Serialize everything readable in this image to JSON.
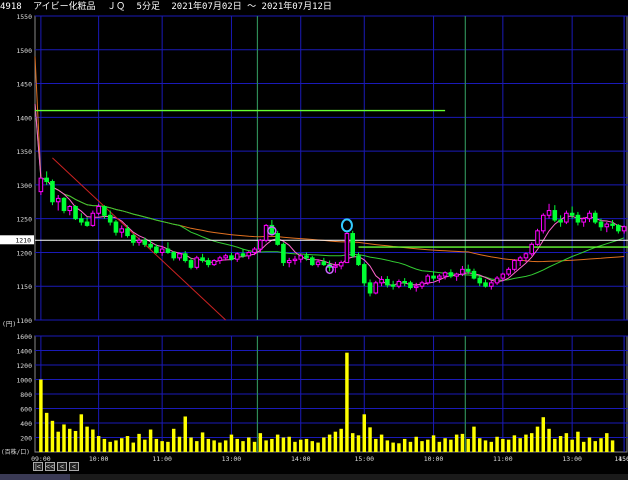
{
  "header": {
    "code": "4918",
    "name": "アイビー化粧品",
    "market": "ＪＱ",
    "interval": "5分足",
    "date_range": "2021年07月02日 〜 2021年07月12日"
  },
  "colors": {
    "background": "#000000",
    "grid": "#1a1ab8",
    "session_separator": "#2e8b57",
    "candle_up": "#ff00ff",
    "candle_down": "#00ff33",
    "volume": "#ffff00",
    "ma_short": "#ff66cc",
    "ma_mid": "#33cc33",
    "ma_long": "#e07020",
    "trend_line": "#cc2222",
    "resistance_line": "#66ff33",
    "price_line": "#ffffff",
    "marker_blue": "#33ccff",
    "marker_purple": "#cc66ff"
  },
  "price_axis": {
    "ticks": [
      "1550",
      "1500",
      "1450",
      "1400",
      "1350",
      "1300",
      "1250",
      "1200",
      "1150",
      "1100"
    ],
    "current": "1210",
    "unit": "(円)"
  },
  "volume_axis": {
    "ticks": [
      "1600",
      "1400",
      "1200",
      "1000",
      "800",
      "600",
      "400",
      "200"
    ],
    "unit": "(百株/口)"
  },
  "time_axis": {
    "labels": [
      "09:00",
      "10:00",
      "11:00",
      "13:00",
      "14:00",
      "15:00",
      "10:00",
      "11:00",
      "13:00",
      "14:00",
      "15:"
    ]
  },
  "nav": {
    "first": "|<",
    "prev_page": "<<",
    "prev": "<",
    "next": "<"
  },
  "chart_data": {
    "type": "candlestick",
    "ylim": [
      1100,
      1550
    ],
    "volume_ylim": [
      0,
      1600
    ],
    "session_breaks_at_index": [
      38,
      74,
      110
    ],
    "resistance_level": 1410,
    "current_price": 1210,
    "candles": [
      [
        1290,
        1310,
        1285,
        1310
      ],
      [
        1310,
        1320,
        1300,
        1305
      ],
      [
        1305,
        1308,
        1270,
        1275
      ],
      [
        1275,
        1285,
        1262,
        1280
      ],
      [
        1280,
        1282,
        1258,
        1262
      ],
      [
        1262,
        1270,
        1255,
        1268
      ],
      [
        1268,
        1270,
        1248,
        1250
      ],
      [
        1250,
        1258,
        1240,
        1245
      ],
      [
        1245,
        1252,
        1238,
        1240
      ],
      [
        1240,
        1262,
        1238,
        1258
      ],
      [
        1258,
        1272,
        1255,
        1268
      ],
      [
        1268,
        1270,
        1250,
        1255
      ],
      [
        1255,
        1262,
        1240,
        1245
      ],
      [
        1245,
        1248,
        1225,
        1230
      ],
      [
        1230,
        1240,
        1222,
        1235
      ],
      [
        1235,
        1240,
        1222,
        1225
      ],
      [
        1225,
        1228,
        1210,
        1215
      ],
      [
        1215,
        1222,
        1210,
        1218
      ],
      [
        1218,
        1222,
        1208,
        1212
      ],
      [
        1212,
        1218,
        1205,
        1208
      ],
      [
        1208,
        1212,
        1198,
        1200
      ],
      [
        1200,
        1210,
        1195,
        1205
      ],
      [
        1205,
        1215,
        1198,
        1200
      ],
      [
        1200,
        1202,
        1188,
        1192
      ],
      [
        1192,
        1200,
        1188,
        1198
      ],
      [
        1198,
        1202,
        1185,
        1188
      ],
      [
        1188,
        1192,
        1175,
        1178
      ],
      [
        1178,
        1195,
        1175,
        1192
      ],
      [
        1192,
        1198,
        1185,
        1188
      ],
      [
        1188,
        1192,
        1178,
        1182
      ],
      [
        1182,
        1190,
        1180,
        1188
      ],
      [
        1188,
        1195,
        1183,
        1192
      ],
      [
        1192,
        1198,
        1188,
        1195
      ],
      [
        1195,
        1200,
        1188,
        1190
      ],
      [
        1190,
        1200,
        1186,
        1198
      ],
      [
        1198,
        1205,
        1192,
        1195
      ],
      [
        1195,
        1202,
        1190,
        1200
      ],
      [
        1200,
        1208,
        1196,
        1205
      ],
      [
        1205,
        1220,
        1200,
        1218
      ],
      [
        1218,
        1242,
        1215,
        1240
      ],
      [
        1240,
        1248,
        1225,
        1228
      ],
      [
        1228,
        1232,
        1210,
        1212
      ],
      [
        1212,
        1215,
        1180,
        1185
      ],
      [
        1185,
        1192,
        1178,
        1188
      ],
      [
        1188,
        1195,
        1182,
        1190
      ],
      [
        1190,
        1198,
        1185,
        1195
      ],
      [
        1195,
        1200,
        1188,
        1192
      ],
      [
        1192,
        1195,
        1180,
        1182
      ],
      [
        1182,
        1190,
        1178,
        1186
      ],
      [
        1186,
        1192,
        1180,
        1182
      ],
      [
        1182,
        1188,
        1172,
        1178
      ],
      [
        1178,
        1186,
        1170,
        1180
      ],
      [
        1180,
        1188,
        1175,
        1185
      ],
      [
        1185,
        1230,
        1185,
        1228
      ],
      [
        1228,
        1232,
        1192,
        1195
      ],
      [
        1195,
        1200,
        1180,
        1182
      ],
      [
        1182,
        1185,
        1150,
        1155
      ],
      [
        1155,
        1160,
        1135,
        1140
      ],
      [
        1140,
        1158,
        1138,
        1155
      ],
      [
        1155,
        1165,
        1150,
        1160
      ],
      [
        1160,
        1165,
        1148,
        1152
      ],
      [
        1152,
        1158,
        1145,
        1150
      ],
      [
        1150,
        1160,
        1147,
        1157
      ],
      [
        1157,
        1162,
        1150,
        1155
      ],
      [
        1155,
        1158,
        1145,
        1148
      ],
      [
        1148,
        1155,
        1142,
        1150
      ],
      [
        1150,
        1158,
        1146,
        1155
      ],
      [
        1155,
        1168,
        1152,
        1165
      ],
      [
        1165,
        1172,
        1158,
        1162
      ],
      [
        1162,
        1168,
        1155,
        1165
      ],
      [
        1165,
        1172,
        1160,
        1170
      ],
      [
        1170,
        1175,
        1162,
        1165
      ],
      [
        1165,
        1170,
        1158,
        1168
      ],
      [
        1168,
        1180,
        1165,
        1175
      ],
      [
        1175,
        1182,
        1168,
        1172
      ],
      [
        1172,
        1176,
        1160,
        1162
      ],
      [
        1162,
        1166,
        1150,
        1155
      ],
      [
        1155,
        1160,
        1148,
        1150
      ],
      [
        1150,
        1158,
        1145,
        1155
      ],
      [
        1155,
        1165,
        1152,
        1162
      ],
      [
        1162,
        1170,
        1158,
        1168
      ],
      [
        1168,
        1178,
        1165,
        1175
      ],
      [
        1175,
        1190,
        1172,
        1188
      ],
      [
        1188,
        1195,
        1180,
        1192
      ],
      [
        1192,
        1200,
        1186,
        1198
      ],
      [
        1198,
        1215,
        1195,
        1212
      ],
      [
        1212,
        1235,
        1210,
        1232
      ],
      [
        1232,
        1258,
        1228,
        1255
      ],
      [
        1255,
        1272,
        1250,
        1262
      ],
      [
        1262,
        1270,
        1245,
        1248
      ],
      [
        1248,
        1255,
        1238,
        1245
      ],
      [
        1245,
        1262,
        1242,
        1258
      ],
      [
        1258,
        1268,
        1250,
        1255
      ],
      [
        1255,
        1260,
        1240,
        1245
      ],
      [
        1245,
        1252,
        1238,
        1250
      ],
      [
        1250,
        1262,
        1245,
        1258
      ],
      [
        1258,
        1262,
        1242,
        1245
      ],
      [
        1245,
        1250,
        1232,
        1238
      ],
      [
        1238,
        1245,
        1230,
        1242
      ],
      [
        1242,
        1248,
        1235,
        1240
      ],
      [
        1240,
        1242,
        1228,
        1232
      ],
      [
        1232,
        1240,
        1228,
        1238
      ]
    ],
    "volume": [
      1000,
      540,
      430,
      280,
      380,
      320,
      290,
      520,
      350,
      310,
      220,
      180,
      140,
      160,
      190,
      220,
      130,
      250,
      170,
      310,
      180,
      150,
      140,
      320,
      210,
      490,
      200,
      150,
      270,
      180,
      160,
      130,
      160,
      240,
      180,
      150,
      200,
      140,
      260,
      160,
      180,
      240,
      200,
      210,
      140,
      170,
      180,
      150,
      130,
      200,
      240,
      280,
      320,
      1370,
      260,
      230,
      520,
      340,
      180,
      240,
      160,
      130,
      120,
      180,
      140,
      210,
      150,
      170,
      230,
      140,
      190,
      170,
      240,
      250,
      180,
      350,
      190,
      160,
      140,
      210,
      180,
      170,
      230,
      190,
      240,
      260,
      350,
      480,
      320,
      180,
      220,
      260,
      170,
      280,
      140,
      200,
      150,
      190,
      260,
      160
    ]
  }
}
